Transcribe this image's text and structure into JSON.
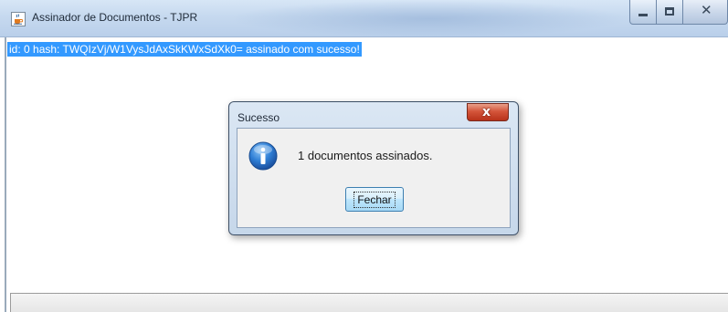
{
  "window": {
    "title": "Assinador de Documentos - TJPR",
    "icon": "java-cup-icon",
    "controls": [
      "minimize",
      "maximize",
      "close"
    ]
  },
  "log": {
    "lines": [
      "id: 0 hash: TWQIzVj/W1VysJdAxSkKWxSdXk0= assinado com sucesso!"
    ]
  },
  "dialog": {
    "title": "Sucesso",
    "icon": "info-icon",
    "message": "1 documentos assinados.",
    "button_label": "Fechar"
  },
  "colors": {
    "selection": "#3399ff",
    "titlebar": "#c6d9ef",
    "dialog_body": "#f0f0f0"
  }
}
